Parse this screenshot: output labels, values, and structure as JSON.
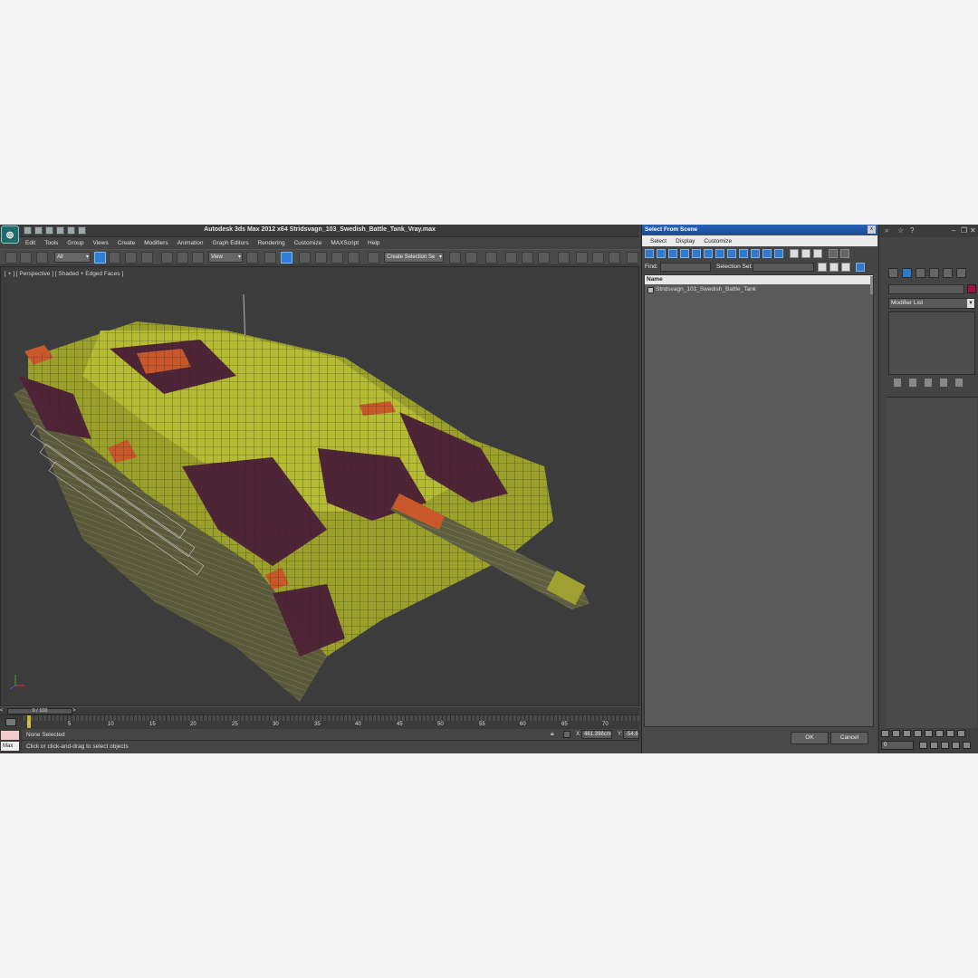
{
  "app": {
    "logo_icon": "3ds-max-logo-icon",
    "title": "Autodesk 3ds Max  2012 x64     Stridsvagn_103_Swedish_Battle_Tank_Vray.max"
  },
  "menu": [
    "Edit",
    "Tools",
    "Group",
    "Views",
    "Create",
    "Modifiers",
    "Animation",
    "Graph Editors",
    "Rendering",
    "Customize",
    "MAXScript",
    "Help"
  ],
  "toolbar": {
    "selection_filter": "All",
    "reference_coord": "View",
    "named_selection": "Create Selection Se"
  },
  "viewport": {
    "label": "[ + ] [ Perspective ] [ Shaded + Edged Faces ]"
  },
  "timeline": {
    "slider_label": "0 / 100",
    "prev": "<",
    "next": ">",
    "ticks": [
      "0",
      "5",
      "10",
      "15",
      "20",
      "25",
      "30",
      "35",
      "40",
      "45",
      "50",
      "55",
      "60",
      "65",
      "70"
    ]
  },
  "status": {
    "selection": "None Selected",
    "prompt": "Click or click-and-drag to select objects",
    "max_label": "Max",
    "x_label": "X:",
    "x_value": "461.398cm",
    "y_label": "Y:",
    "y_value": "-54.6"
  },
  "dialog": {
    "title": "Select From Scene",
    "close": "x",
    "menu": [
      "Select",
      "Display",
      "Customize"
    ],
    "find_label": "Find:",
    "selection_set_label": "Selection Set:",
    "column_name": "Name",
    "items": [
      "Stridsvagn_103_Swedish_Battle_Tank"
    ],
    "ok": "OK",
    "cancel": "Cancel"
  },
  "command_panel": {
    "modifier_list": "Modifier List",
    "frame_value": "0",
    "object_color": "#a0103a"
  }
}
